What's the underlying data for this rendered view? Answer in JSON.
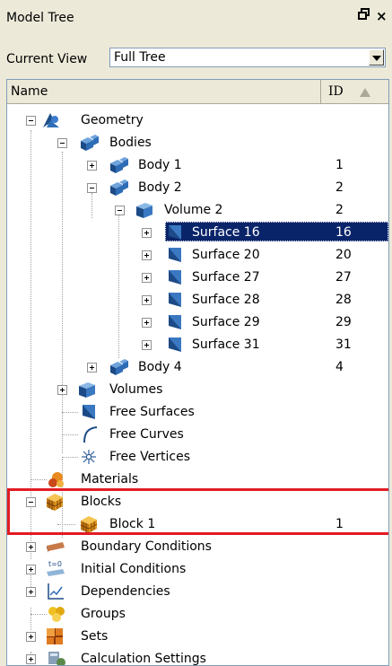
{
  "panel": {
    "title": "Model Tree",
    "pin_glyph": "⊙",
    "close_glyph": "×"
  },
  "view": {
    "label": "Current View",
    "value": "Full Tree"
  },
  "columns": {
    "name": "Name",
    "id": "ID"
  },
  "tree": {
    "geometry": "Geometry",
    "bodies": "Bodies",
    "body1": {
      "label": "Body 1",
      "id": "1"
    },
    "body2": {
      "label": "Body 2",
      "id": "2"
    },
    "volume2": {
      "label": "Volume 2",
      "id": "2"
    },
    "surfaces": [
      {
        "label": "Surface 16",
        "id": "16",
        "selected": true
      },
      {
        "label": "Surface 20",
        "id": "20"
      },
      {
        "label": "Surface 27",
        "id": "27"
      },
      {
        "label": "Surface 28",
        "id": "28"
      },
      {
        "label": "Surface 29",
        "id": "29"
      },
      {
        "label": "Surface 31",
        "id": "31"
      }
    ],
    "body4": {
      "label": "Body 4",
      "id": "4"
    },
    "volumes": "Volumes",
    "free_surfaces": "Free Surfaces",
    "free_curves": "Free Curves",
    "free_vertices": "Free Vertices",
    "materials": "Materials",
    "blocks": "Blocks",
    "block1": {
      "label": "Block 1",
      "id": "1"
    },
    "boundary_conditions": "Boundary Conditions",
    "initial_conditions": "Initial Conditions",
    "dependencies": "Dependencies",
    "groups": "Groups",
    "sets": "Sets",
    "calculation_settings": "Calculation Settings"
  },
  "colors": {
    "selection": "#0a246a",
    "highlight_box": "#e31b23"
  }
}
